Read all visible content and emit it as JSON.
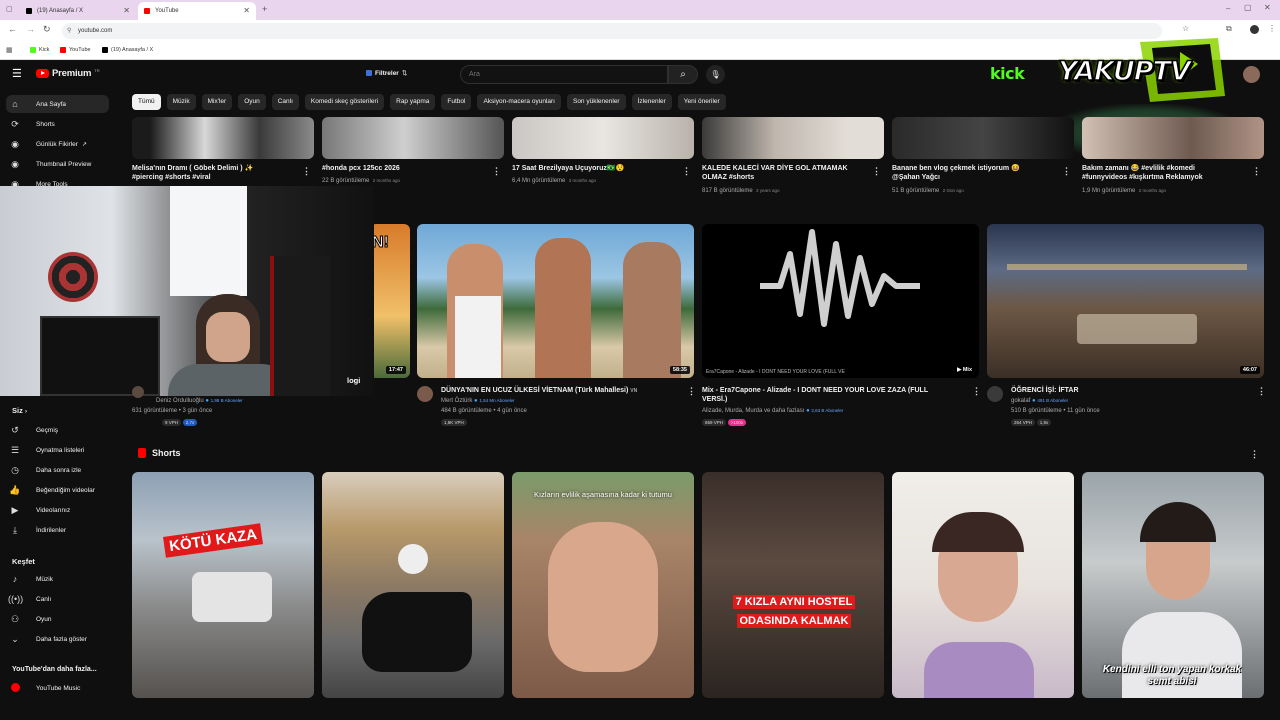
{
  "browser": {
    "tabs": [
      {
        "title": "(19) Anasayfa / X"
      },
      {
        "title": "YouTube"
      }
    ],
    "url": "youtube.com",
    "bookmarks": [
      "Kick",
      "YouTube",
      "(19) Anasayfa / X"
    ]
  },
  "masthead": {
    "logo": "Premium",
    "logo_sup": "TR",
    "filters_label": "Filtreler",
    "search_placeholder": "Ara"
  },
  "overlay": {
    "kick": "kick",
    "brand": "YAKUPTV",
    "webcam_label": "logi"
  },
  "chips": [
    "Tümü",
    "Müzik",
    "Mix'ler",
    "Oyun",
    "Canlı",
    "Komedi skeç gösterileri",
    "Rap yapma",
    "Futbol",
    "Aksiyon-macera oyunları",
    "Son yüklenenler",
    "İzlenenler",
    "Yeni öneriler"
  ],
  "sidebar": {
    "top": [
      {
        "label": "Ana Sayfa",
        "icon": "home-icon"
      },
      {
        "label": "Shorts",
        "icon": "shorts-icon"
      },
      {
        "label": "Günlük Fikirler",
        "icon": "extension-icon"
      },
      {
        "label": "Thumbnail Preview",
        "icon": "extension-icon"
      },
      {
        "label": "More Tools",
        "icon": "extension-icon"
      }
    ],
    "you_heading": "Siz",
    "you": [
      {
        "label": "Geçmiş",
        "icon": "history-icon"
      },
      {
        "label": "Oynatma listeleri",
        "icon": "playlist-icon"
      },
      {
        "label": "Daha sonra izle",
        "icon": "clock-icon"
      },
      {
        "label": "Beğendiğim videolar",
        "icon": "like-icon"
      },
      {
        "label": "Videolarınız",
        "icon": "video-icon"
      },
      {
        "label": "İndirilenler",
        "icon": "download-icon"
      }
    ],
    "explore_heading": "Keşfet",
    "explore": [
      {
        "label": "Müzik",
        "icon": "music-icon"
      },
      {
        "label": "Canlı",
        "icon": "live-icon"
      },
      {
        "label": "Oyun",
        "icon": "game-icon"
      },
      {
        "label": "Daha fazla göster",
        "icon": "chevron-down-icon"
      }
    ],
    "more_heading": "YouTube'dan daha fazla...",
    "more": [
      {
        "label": "YouTube Music",
        "icon": "youtube-music-icon"
      }
    ]
  },
  "row1": [
    {
      "title_l1": "Melisa'nın Dramı ( Göbek Delimi ) ✨",
      "title_l2": "#piercing #shorts #viral",
      "views": "",
      "age": ""
    },
    {
      "title_l1": "#honda pcx 125cc 2026",
      "title_l2": "",
      "views": "22 B görüntüleme",
      "age": "2 months ago"
    },
    {
      "title_l1": "17 Saat Brezilyaya Uçuyoruz🇧🇷😯",
      "title_l2": "",
      "views": "6,4 Mn görüntüleme",
      "age": "3 months ago"
    },
    {
      "title_l1": "KALEDE KALECİ VAR DİYE GOL ATMAMAK",
      "title_l2": "OLMAZ #shorts",
      "views": "817 B görüntüleme",
      "age": "3 years ago"
    },
    {
      "title_l1": "Banane ben vlog çekmek istiyorum 😆",
      "title_l2": "@Şahan Yağcı",
      "views": "51 B görüntüleme",
      "age": "2 Gün ago"
    },
    {
      "title_l1": "Bakım zamanı 😂 #evlilik #komedi",
      "title_l2": "#funnyvideos #kışkırtma Reklamyok",
      "views": "1,9 Mn görüntüleme",
      "age": "2 months ago"
    }
  ],
  "row2": [
    {
      "duration": "17:47",
      "channel": "Deniz Ordulluoğlu",
      "subs": "1,98 B Aboneler",
      "stats": "631 görüntüleme • 3 gün önce",
      "vph": "9 VPH",
      "badge": "2,7x",
      "badge_color": "#1e5bb8",
      "title_l1": "",
      "title_l2": ""
    },
    {
      "duration": "58:35",
      "channel": "Mert Öztürk",
      "subs": "1,54 Mn Aboneler",
      "stats": "484 B görüntüleme • 4 gün önce",
      "vph": "1,8K VPH",
      "badge": "",
      "badge_color": "",
      "title_l1": "DÜNYA'NIN EN UCUZ ÜLKESİ VİETNAM (Türk Mahallesi)",
      "title_l2": "",
      "tag": "VN"
    },
    {
      "duration": "Mix",
      "channel": "Alizade, Murda, Murda ve daha fazlası",
      "subs": "2,63 B Aboneler",
      "stats": "",
      "vph": "659 VPH",
      "badge": ">100x",
      "badge_color": "#e0328c",
      "title_l1": "Mix - Era7Capone - Alizade - I DONT NEED YOUR LOVE ZAZA (FULL",
      "title_l2": "VERSİ.)",
      "overlay": "Era7Capone - Alizade - I DONT NEED YOUR LOVE (FULL VE"
    },
    {
      "duration": "46:07",
      "channel": "gokalaf",
      "subs": "491 B Aboneler",
      "stats": "510 B görüntüleme • 11 gün önce",
      "vph": "264 VPH",
      "badge": "1,9x",
      "badge_color": "#2a2a2a",
      "title_l1": "ÖĞRENCİ İŞİ: İFTAR",
      "title_l2": ""
    }
  ],
  "shorts": {
    "heading": "Shorts",
    "items": [
      {
        "overlay": "KÖTÜ KAZA"
      },
      {
        "overlay": ""
      },
      {
        "overlay": "Kızların evlilik aşamasına kadar ki tutumu"
      },
      {
        "overlay": "7 KIZLA AYNI HOSTEL ODASINDA KALMAK"
      },
      {
        "overlay": ""
      },
      {
        "overlay": "Kendini elli ton yapan korkak semt abisi"
      }
    ]
  },
  "colors": {
    "brand_red": "#ff0000",
    "bg": "#0f0f0f",
    "chip": "#272727",
    "kick_green": "#53fc18",
    "overlay_green": "#8bd400"
  }
}
